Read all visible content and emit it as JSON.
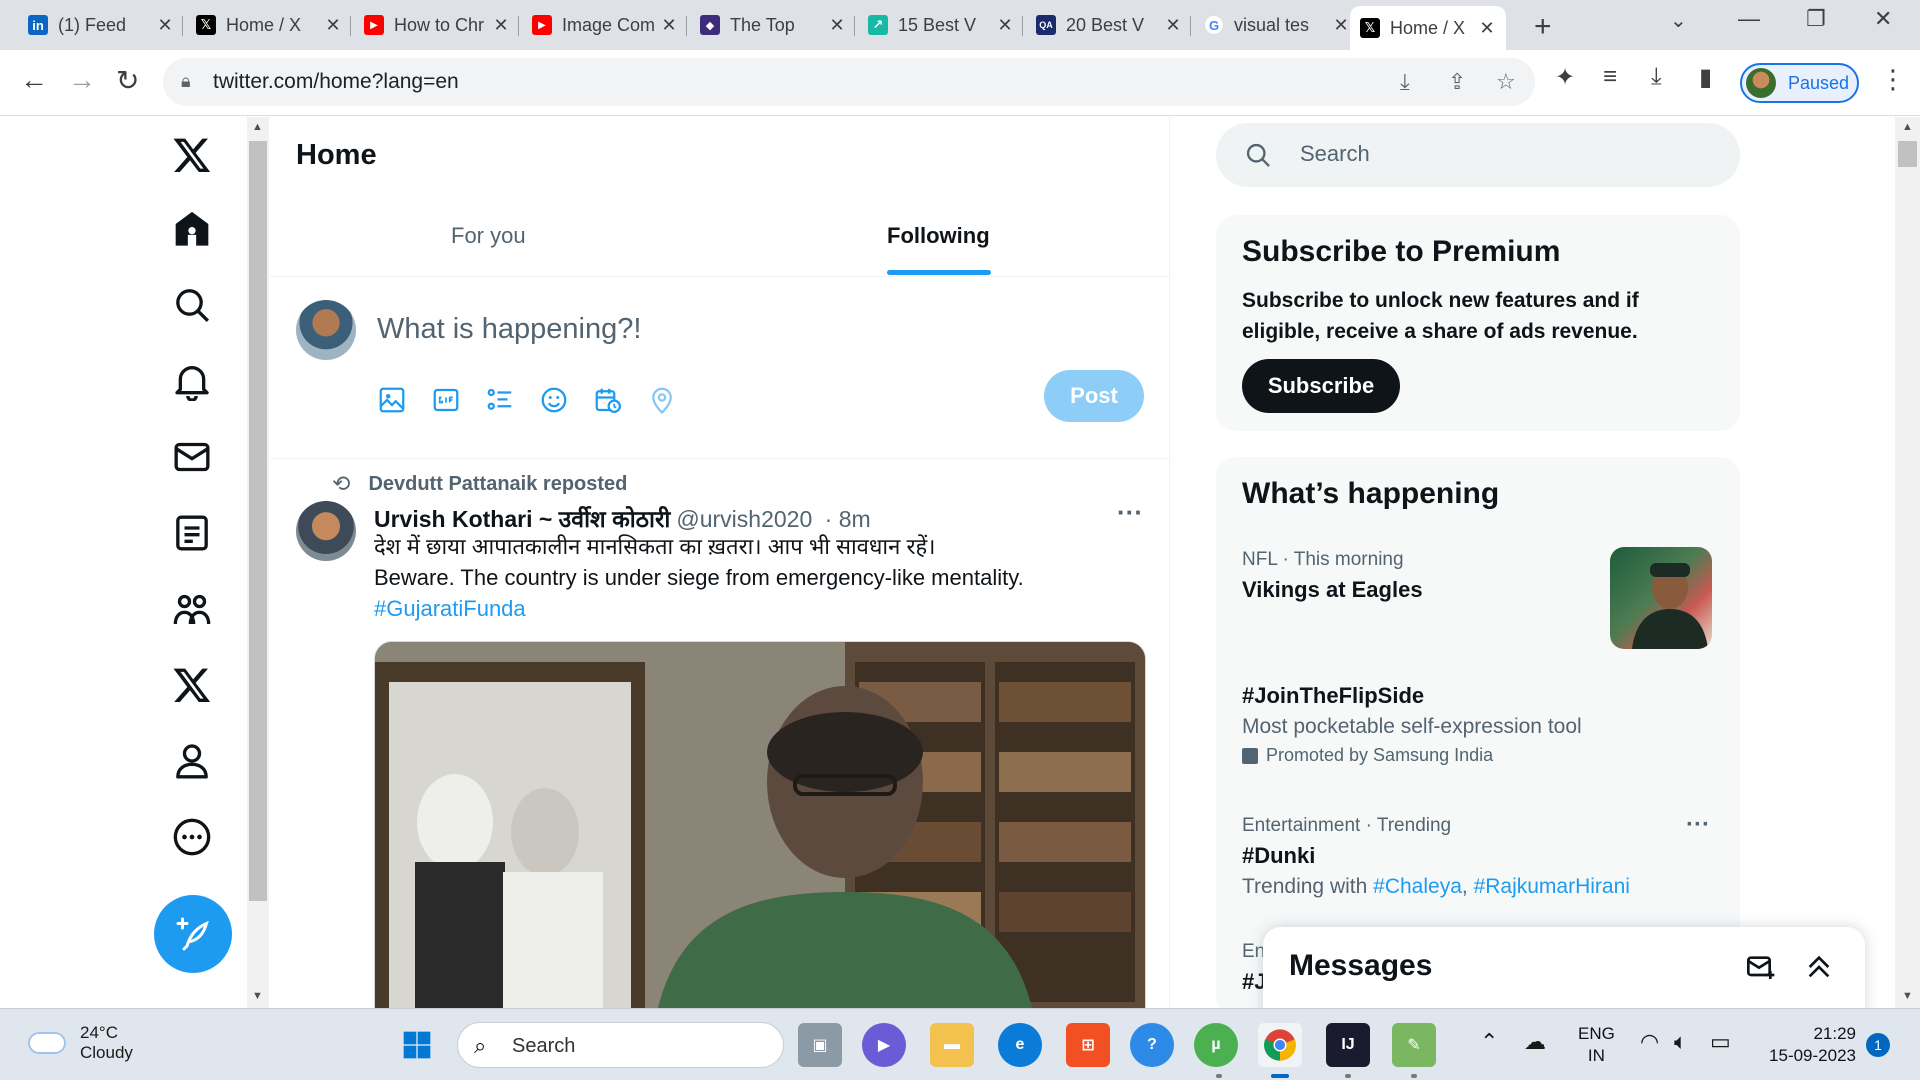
{
  "browser": {
    "tabs": [
      {
        "title": "(1) Feed",
        "icon": "linkedin-icon",
        "color": "#0a66c2",
        "glyph": "in"
      },
      {
        "title": "Home / X",
        "icon": "x-logo-icon",
        "color": "#000000",
        "glyph": "𝕏"
      },
      {
        "title": "How to Chr",
        "icon": "youtube-icon",
        "color": "#ff0000",
        "glyph": "▶"
      },
      {
        "title": "Image Com",
        "icon": "youtube-icon",
        "color": "#ff0000",
        "glyph": "▶"
      },
      {
        "title": "The Top",
        "icon": "shield-logo-icon",
        "color": "#3c2d7a",
        "glyph": "◆"
      },
      {
        "title": "15 Best V",
        "icon": "chart-logo-icon",
        "color": "#17b9a4",
        "glyph": "↗"
      },
      {
        "title": "20 Best V",
        "icon": "qa-logo-icon",
        "color": "#1a2b6b",
        "glyph": "QA"
      },
      {
        "title": "visual tes",
        "icon": "google-icon",
        "color": "#4285f4",
        "glyph": "G"
      },
      {
        "title": "Home / X",
        "icon": "x-logo-icon",
        "color": "#000000",
        "glyph": "𝕏",
        "active": true
      }
    ],
    "url": "twitter.com/home?lang=en",
    "profile_label": "Paused"
  },
  "twitter": {
    "page_title": "Home",
    "feed_tabs": {
      "for_you": "For you",
      "following": "Following"
    },
    "composer": {
      "placeholder": "What is happening?!",
      "post_label": "Post"
    },
    "tweet": {
      "repost_by": "Devdutt Pattanaik reposted",
      "author": "Urvish Kothari ~ उर्वीश कोठारी",
      "handle": "@urvish2020",
      "time": "· 8m",
      "line1": "देश में छाया आपातकालीन मानसिकता का ख़तरा। आप भी सावधान रहें।",
      "line2": "Beware. The country is under siege from emergency-like mentality.",
      "hashtag": "#GujaratiFunda"
    },
    "search_placeholder": "Search",
    "premium": {
      "title": "Subscribe to Premium",
      "text": "Subscribe to unlock new features and if eligible, receive a share of ads revenue.",
      "button": "Subscribe"
    },
    "whats_happening": {
      "title": "What’s happening",
      "trends": [
        {
          "meta": "NFL · This morning",
          "title": "Vikings at Eagles"
        },
        {
          "title": "#JoinTheFlipSide",
          "sub": "Most pocketable self-expression tool",
          "promo": "Promoted by Samsung India"
        },
        {
          "meta": "Entertainment · Trending",
          "title": "#Dunki",
          "sub_prefix": "Trending with",
          "tag1": "#Chaleya",
          "sep": ",",
          "tag2": "#RajkumarHirani"
        },
        {
          "meta": "En",
          "title": "#J"
        }
      ]
    },
    "messages_title": "Messages",
    "brand_color": "#1d9bf0"
  },
  "taskbar": {
    "weather_temp": "24°C",
    "weather_desc": "Cloudy",
    "search_placeholder": "Search",
    "lang_line1": "ENG",
    "lang_line2": "IN",
    "time": "21:29",
    "date": "15-09-2023",
    "notification_count": "1"
  }
}
